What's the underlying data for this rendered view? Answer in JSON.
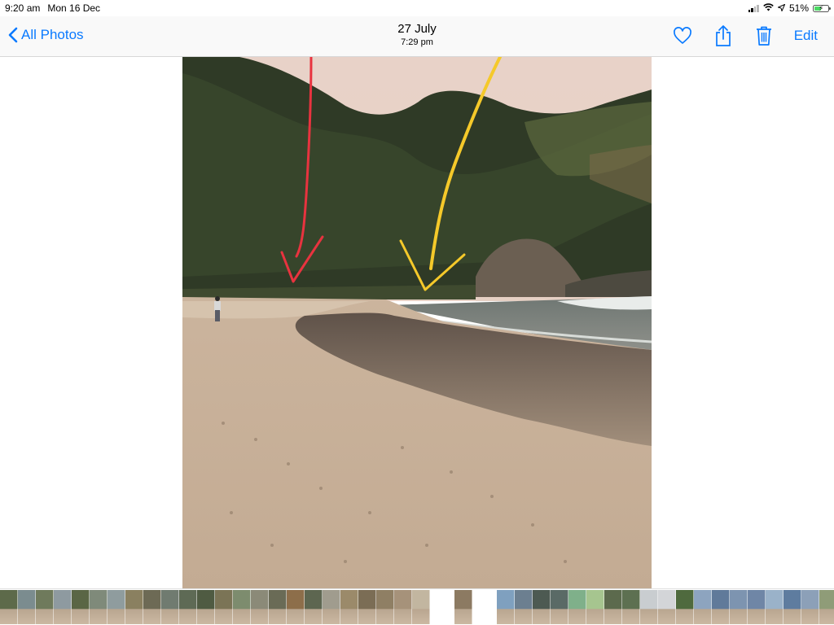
{
  "status_bar": {
    "time": "9:20 am",
    "date": "Mon 16 Dec",
    "battery_percent": "51%",
    "battery_level": 0.51,
    "icons": [
      "signal-icon",
      "wifi-icon",
      "location-icon",
      "battery-icon"
    ]
  },
  "nav": {
    "back_label": "All Photos",
    "title_date": "27 July",
    "title_time": "7:29 pm",
    "edit_label": "Edit",
    "actions": [
      "heart-icon",
      "share-icon",
      "trash-icon"
    ]
  },
  "colors": {
    "accent": "#0a7aff",
    "red_arrow": "#e8333f",
    "yellow_arrow": "#f5c92a"
  },
  "photo": {
    "subject": "beach photo with red and yellow hand-drawn arrows"
  },
  "filmstrip": {
    "thumbnails": [
      "#5d6a4a",
      "#7b8c8f",
      "#6f7a5c",
      "#8e9aa0",
      "#5a6645",
      "#7f8a7a",
      "#8f9c9e",
      "#8a8060",
      "#6d6a55",
      "#707b70",
      "#5e6a55",
      "#4f5b42",
      "#7b7456",
      "#7d8c6e",
      "#8b8a78",
      "#6a6b56",
      "#8d6e4a",
      "#5d6650",
      "#a09c8e",
      "#9b8a6a",
      "#7b6d55",
      "#8f7f64",
      "#a6927a",
      "#c2b6a0",
      "gap",
      "#8c7a62",
      "gap",
      "#7fa0bf",
      "#6c7f90",
      "#4d5a52",
      "#5a6a66",
      "#7fb08a",
      "#a6c58f",
      "#5c6a4d",
      "#5d7051",
      "#c9cdd0",
      "#d3d5d8",
      "#4f6a3e",
      "#8da4bf",
      "#607a9a",
      "#7d94b0",
      "#6f86a6",
      "#9ab2c9",
      "#5e7c9f",
      "#8ca0b8",
      "#8f9c78",
      "#a8b2b8",
      "#5e5e5e",
      "#7a6f5a",
      "#8e7a62",
      "#a69a88",
      "#7b6f5e"
    ],
    "current_index": 26
  }
}
